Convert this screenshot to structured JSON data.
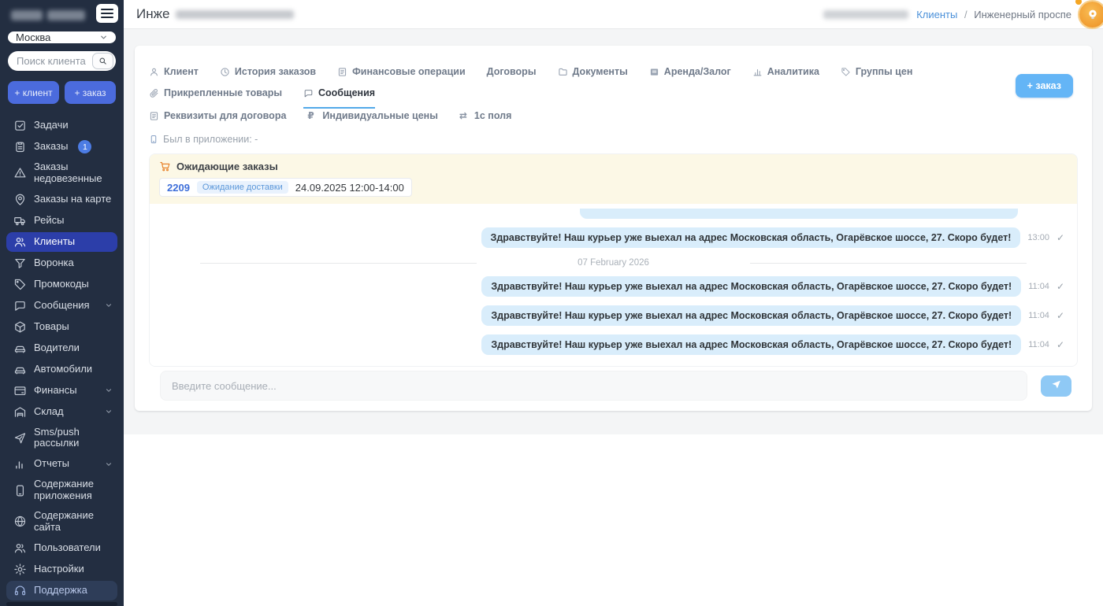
{
  "colors": {
    "sidebar_bg": "#232e41",
    "sidebar_active": "#2c3ea9",
    "primary_button": "#4b6bdd",
    "light_blue_button": "#64b5f6",
    "send_button": "#8fc9f5",
    "bubble": "#d9edfb",
    "pending_banner": "#fcf8e6",
    "link": "#4a90d9",
    "tab_active_underline": "#52a9e9",
    "badge": "#4c7ce4",
    "cart_icon": "#e8832c",
    "avatar_orange": "#f09a2e"
  },
  "app": {
    "region": "Москва",
    "search_placeholder": "Поиск клиента",
    "add_client_label": "+ клиент",
    "add_order_label": "+ заказ"
  },
  "sidebar": {
    "items": [
      {
        "name": "tasks",
        "icon": "task-icon",
        "label": "Задачи"
      },
      {
        "name": "orders",
        "icon": "clipboard-icon",
        "label": "Заказы",
        "badge": "1"
      },
      {
        "name": "orders-undelivered",
        "icon": "warning-icon",
        "label": "Заказы недовезенные"
      },
      {
        "name": "orders-map",
        "icon": "pin-icon",
        "label": "Заказы на карте"
      },
      {
        "name": "trips",
        "icon": "truck-icon",
        "label": "Рейсы"
      },
      {
        "name": "clients",
        "icon": "users-icon",
        "label": "Клиенты",
        "active": true
      },
      {
        "name": "funnel",
        "icon": "funnel-icon",
        "label": "Воронка"
      },
      {
        "name": "promocodes",
        "icon": "tag-icon",
        "label": "Промокоды"
      },
      {
        "name": "messages",
        "icon": "chat-icon",
        "label": "Сообщения",
        "chevron": true
      },
      {
        "name": "products",
        "icon": "cube-icon",
        "label": "Товары"
      },
      {
        "name": "drivers",
        "icon": "car-icon",
        "label": "Водители"
      },
      {
        "name": "cars",
        "icon": "car-icon",
        "label": "Автомобили"
      },
      {
        "name": "finances",
        "icon": "card-icon",
        "label": "Финансы",
        "chevron": true
      },
      {
        "name": "warehouse",
        "icon": "warehouse-icon",
        "label": "Склад",
        "chevron": true
      },
      {
        "name": "sms-push",
        "icon": "send-icon",
        "label": "Sms/push рассылки"
      },
      {
        "name": "reports",
        "icon": "chart-icon",
        "label": "Отчеты",
        "chevron": true
      },
      {
        "name": "app-content",
        "icon": "phone-icon",
        "label": "Содержание приложения"
      },
      {
        "name": "site-content",
        "icon": "globe-icon",
        "label": "Содержание сайта"
      },
      {
        "name": "users",
        "icon": "users-icon",
        "label": "Пользователи"
      },
      {
        "name": "settings",
        "icon": "gear-icon",
        "label": "Настройки"
      },
      {
        "name": "support",
        "icon": "headset-icon",
        "label": "Поддержка",
        "hover": true
      }
    ]
  },
  "header": {
    "title_visible": "Инже",
    "breadcrumb": {
      "link": "Клиенты",
      "separator": "/",
      "current": "Инженерный проспе"
    }
  },
  "tabs": {
    "row1": [
      {
        "name": "client",
        "icon": "person-icon",
        "label": "Клиент"
      },
      {
        "name": "order-history",
        "icon": "clock-icon",
        "label": "История заказов"
      },
      {
        "name": "finance-operations",
        "icon": "doc-icon",
        "label": "Финансовые операции"
      },
      {
        "name": "contracts",
        "label": "Договоры"
      },
      {
        "name": "documents",
        "icon": "folder-icon",
        "label": "Документы"
      },
      {
        "name": "rent-deposit",
        "icon": "deposit-icon",
        "label": "Аренда/Залог"
      },
      {
        "name": "analytics",
        "icon": "bars-icon",
        "label": "Аналитика"
      },
      {
        "name": "price-groups",
        "icon": "tag-icon",
        "label": "Группы цен"
      },
      {
        "name": "attached-products",
        "icon": "paperclip-icon",
        "label": "Прикрепленные товары"
      },
      {
        "name": "messages",
        "icon": "chat-icon",
        "label": "Сообщения",
        "active": true
      }
    ],
    "row2": [
      {
        "name": "contract-details",
        "icon": "doc-icon",
        "label": "Реквизиты для договора"
      },
      {
        "name": "individual-prices",
        "icon": "ruble-icon",
        "label": "Индивидуальные цены"
      },
      {
        "name": "1c-fields",
        "icon": "arrows-icon",
        "label": "1с поля"
      }
    ],
    "add_order_label": "+ заказ"
  },
  "client_info": {
    "last_in_app": "Был в приложении: -"
  },
  "pending_orders": {
    "title": "Ожидающие заказы",
    "order": {
      "number": "2209",
      "status": "Ожидание доставки",
      "datetime": "24.09.2025 12:00-14:00"
    }
  },
  "chat": {
    "messages": [
      {
        "type": "cut"
      },
      {
        "type": "msg",
        "text": "Здравствуйте! Наш курьер уже выехал на адрес Московская область, Огарёвское шоссе, 27. Скоро будет!",
        "time": "13:00",
        "check": "✓"
      },
      {
        "type": "divider",
        "label": "07 February 2026"
      },
      {
        "type": "msg",
        "text": "Здравствуйте! Наш курьер уже выехал на адрес Московская область, Огарёвское шоссе, 27. Скоро будет!",
        "time": "11:04",
        "check": "✓"
      },
      {
        "type": "msg",
        "text": "Здравствуйте! Наш курьер уже выехал на адрес Московская область, Огарёвское шоссе, 27. Скоро будет!",
        "time": "11:04",
        "check": "✓"
      },
      {
        "type": "msg",
        "text": "Здравствуйте! Наш курьер уже выехал на адрес Московская область, Огарёвское шоссе, 27. Скоро будет!",
        "time": "11:04",
        "check": "✓"
      }
    ],
    "input_placeholder": "Введите сообщение..."
  }
}
